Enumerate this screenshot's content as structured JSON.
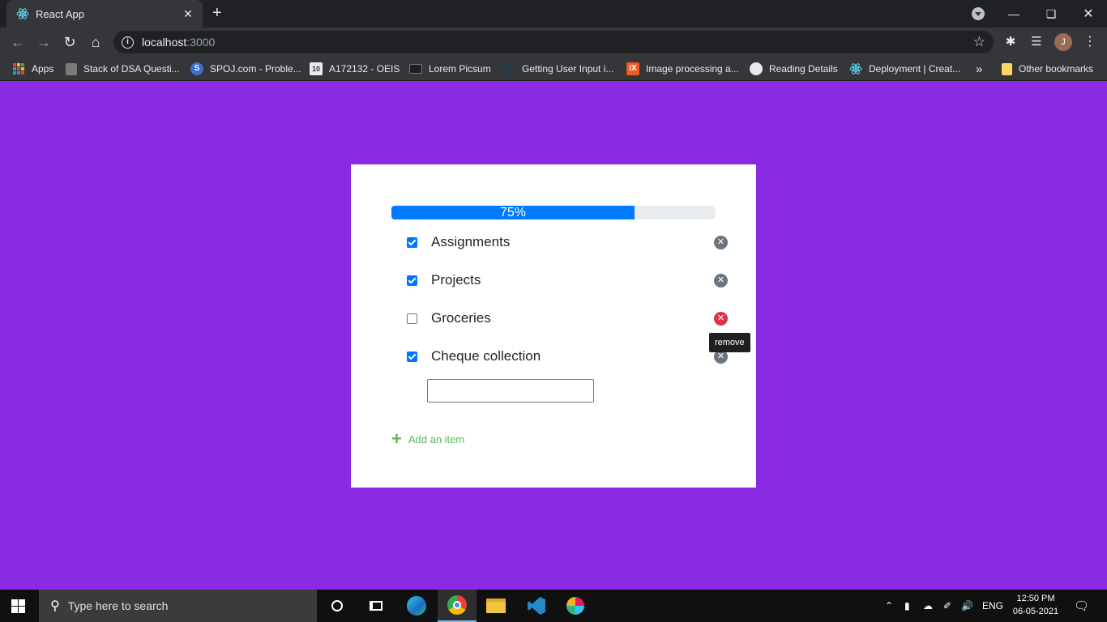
{
  "browser": {
    "tab_title": "React App",
    "tab_close": "✕",
    "new_tab": "+",
    "url_host": "localhost",
    "url_port": ":3000",
    "profile_initial": "J",
    "bookmarks": [
      {
        "label": "Apps",
        "icon": "apps-grid-icon"
      },
      {
        "label": "Stack of DSA Questi...",
        "icon": "stack-icon"
      },
      {
        "label": "SPOJ.com - Proble...",
        "icon": "spoj-icon"
      },
      {
        "label": "A172132 - OEIS",
        "icon": "oeis-icon"
      },
      {
        "label": "Lorem Picsum",
        "icon": "image-icon"
      },
      {
        "label": "Getting User Input i...",
        "icon": "globe-dark-icon"
      },
      {
        "label": "Image processing a...",
        "icon": "ix-icon"
      },
      {
        "label": "Reading Details",
        "icon": "globe-icon"
      },
      {
        "label": "Deployment | Creat...",
        "icon": "react-icon"
      }
    ],
    "more_bookmarks": "»",
    "other_bookmarks": "Other bookmarks"
  },
  "app": {
    "progress_label": "75%",
    "progress_fraction": 0.75,
    "todos": [
      {
        "label": "Assignments",
        "checked": true
      },
      {
        "label": "Projects",
        "checked": true
      },
      {
        "label": "Groceries",
        "checked": false
      },
      {
        "label": "Cheque collection",
        "checked": true
      }
    ],
    "remove_glyph": "✕",
    "tooltip": "remove",
    "add_plus": "+",
    "add_label": "Add an item"
  },
  "taskbar": {
    "search_placeholder": "Type here to search",
    "language": "ENG",
    "time": "12:50 PM",
    "date": "06-05-2021"
  },
  "colors": {
    "page_background": "#8a2be2",
    "progress_fill": "#007bff",
    "remove_hover": "#dc3545",
    "add_green": "#5cb85c"
  }
}
